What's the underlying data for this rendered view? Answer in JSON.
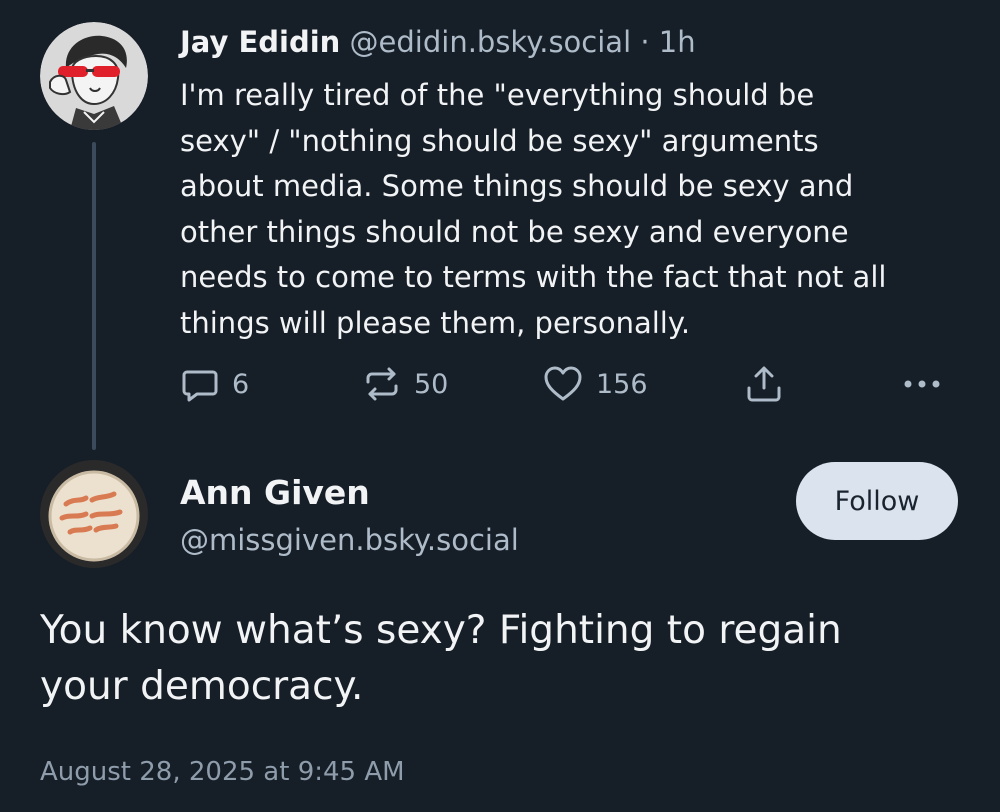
{
  "colors": {
    "background": "#161e27",
    "text_primary": "#f1f3f5",
    "text_secondary": "#aebbc9",
    "thread_line": "#3b4b5c",
    "follow_button_bg": "#dbe4ee",
    "sunglasses_red": "#e0202a",
    "pin_orange": "#d87a52"
  },
  "parent_post": {
    "author": {
      "display_name": "Jay Edidin",
      "handle": "@edidin.bsky.social",
      "avatar_icon": "avatar-illustration-red-sunglasses"
    },
    "separator": "·",
    "relative_time": "1h",
    "text_lines": [
      "I'm really tired of the \"everything should be",
      "sexy\" / \"nothing should be sexy\" arguments",
      "about media. Some things should be sexy and",
      "other things should not be sexy and everyone",
      "needs to come to terms with the fact that not all",
      "things will please them, personally."
    ],
    "actions": {
      "reply": {
        "icon": "reply-icon",
        "count": "6"
      },
      "repost": {
        "icon": "repost-icon",
        "count": "50"
      },
      "like": {
        "icon": "heart-icon",
        "count": "156"
      },
      "share": {
        "icon": "share-icon"
      },
      "more": {
        "icon": "more-options-icon"
      }
    }
  },
  "main_post": {
    "author": {
      "display_name": "Ann Given",
      "handle": "@missgiven.bsky.social",
      "avatar_icon": "avatar-pin-badge"
    },
    "follow_label": "Follow",
    "text_lines": [
      "You know what’s sexy? Fighting to regain",
      "your democracy."
    ],
    "timestamp": "August 28, 2025 at 9:45 AM"
  }
}
